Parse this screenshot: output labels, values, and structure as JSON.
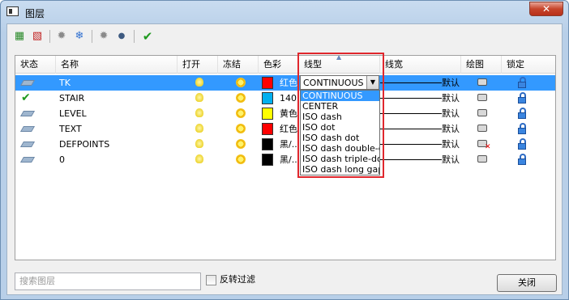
{
  "window": {
    "title": "图层",
    "close_glyph": "✕"
  },
  "toolbar": {
    "items": [
      {
        "name": "new-layer-icon",
        "glyph": "▦"
      },
      {
        "name": "delete-layer-icon",
        "glyph": "▧"
      },
      {
        "name": "light-off-icon",
        "glyph": "✹"
      },
      {
        "name": "snowflake-icon",
        "glyph": "❄"
      },
      {
        "name": "lamp-icon",
        "glyph": "✹"
      },
      {
        "name": "bulb-icon",
        "glyph": "●"
      },
      {
        "name": "check-icon",
        "glyph": "✔"
      }
    ]
  },
  "columns": [
    "状态",
    "名称",
    "打开",
    "冻结",
    "色彩",
    "线型",
    "线宽",
    "绘图",
    "锁定"
  ],
  "rows": [
    {
      "current": false,
      "selected": true,
      "name": "TK",
      "color": "#ff0000",
      "color_label": "红色",
      "lineweight": "默认",
      "plot": true
    },
    {
      "current": true,
      "selected": false,
      "name": "STAIR",
      "color": "#00b0f0",
      "color_label": "140",
      "lineweight": "默认",
      "plot": true
    },
    {
      "current": false,
      "selected": false,
      "name": "LEVEL",
      "color": "#ffff00",
      "color_label": "黄色",
      "lineweight": "默认",
      "plot": true
    },
    {
      "current": false,
      "selected": false,
      "name": "TEXT",
      "color": "#ff0000",
      "color_label": "红色",
      "lineweight": "默认",
      "plot": true
    },
    {
      "current": false,
      "selected": false,
      "name": "DEFPOINTS",
      "color": "#000000",
      "color_label": "黑/...",
      "lineweight": "默认",
      "plot": false
    },
    {
      "current": false,
      "selected": false,
      "name": "0",
      "color": "#000000",
      "color_label": "黑/...",
      "lineweight": "默认",
      "plot": true
    }
  ],
  "linetype_combo": {
    "value": "CONTINUOUS",
    "options": [
      "CONTINUOUS",
      "CENTER",
      "ISO dash",
      "ISO dot",
      "ISO dash dot",
      "ISO dash double-d",
      "ISO dash triple-do",
      "ISO dash long gap"
    ],
    "selected_index": 0
  },
  "footer": {
    "search_placeholder": "搜索图层",
    "invert_filter_label": "反转过滤",
    "close_label": "关闭"
  },
  "colors": {
    "accent": "#3399ff",
    "highlight_box": "#e0272d"
  }
}
